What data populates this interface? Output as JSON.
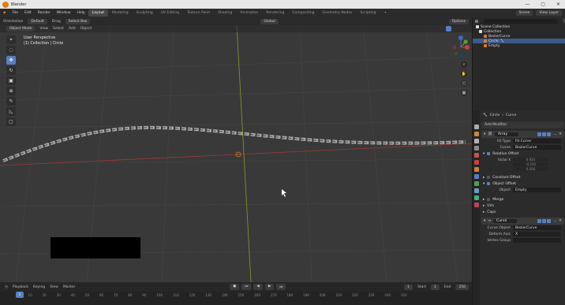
{
  "window": {
    "title": "Blender",
    "controls": [
      "—",
      "▢",
      "✕"
    ]
  },
  "menu": [
    "File",
    "Edit",
    "Render",
    "Window",
    "Help"
  ],
  "workspaces": [
    "Layout",
    "Modeling",
    "Sculpting",
    "UV Editing",
    "Texture Paint",
    "Shading",
    "Animation",
    "Rendering",
    "Compositing",
    "Geometry Nodes",
    "Scripting",
    "+"
  ],
  "active_workspace": "Layout",
  "scene": {
    "label": "Scene",
    "view_layer": "View Layer"
  },
  "tool_header": {
    "orientation": "Orientation",
    "default": "Default",
    "drag": "Drag",
    "select_box": "Select Box"
  },
  "view_header": {
    "mode": "Object Mode",
    "view": "View",
    "select": "Select",
    "add": "Add",
    "object": "Object",
    "global": "Global",
    "options": "Options"
  },
  "viewport": {
    "info_line1": "User Perspective",
    "info_line2": "(1) Collection | Circle"
  },
  "toolbar_icons": [
    "cursor-icon",
    "select-icon",
    "move-icon",
    "rotate-icon",
    "scale-icon",
    "transform-icon",
    "annotate-icon",
    "measure-icon",
    "add-cube-icon"
  ],
  "gizmo": {
    "x": "X",
    "y": "Y",
    "z": "Z"
  },
  "timeline": {
    "playback": "Playback",
    "keying": "Keying",
    "view": "View",
    "marker": "Marker",
    "current_frame": "1",
    "start_label": "Start",
    "start": "1",
    "end_label": "End",
    "end": "250",
    "frame_ticks": [
      "0",
      "10",
      "20",
      "30",
      "40",
      "50",
      "60",
      "70",
      "80",
      "90",
      "100",
      "110",
      "120",
      "130",
      "140",
      "150",
      "160",
      "170",
      "180",
      "190",
      "200",
      "210",
      "220",
      "230",
      "240",
      "250"
    ]
  },
  "outliner": {
    "root": "Scene Collection",
    "collection": "Collection",
    "items": [
      "BezierCurve",
      "Circle",
      "Empty"
    ]
  },
  "properties": {
    "path_object": "Circle",
    "path_data": "Curve",
    "add_modifier": "Add Modifier",
    "array": {
      "name": "Array",
      "fit_type_label": "Fit Type",
      "fit_type": "Fit Curve",
      "curve_label": "Curve",
      "curve": "BezierCurve",
      "relative_offset": "Relative Offset",
      "factor_label": "Factor X",
      "factor_x": "0.920",
      "factor_y": "-0.250",
      "factor_z": "0.000",
      "constant_offset": "Constant Offset",
      "object_offset": "Object Offset",
      "object_label": "Object",
      "object": "Empty",
      "merge": "Merge",
      "uvs": "UVs",
      "caps": "Caps"
    },
    "curve_mod": {
      "name": "Curve",
      "curve_object_label": "Curve Object",
      "curve_object": "BezierCurve",
      "deform_axis_label": "Deform Axis",
      "deform_axis": "X",
      "vertex_group_label": "Vertex Group"
    }
  },
  "colors": {
    "accent": "#5680c2",
    "x_axis": "#9b3a3a",
    "y_axis": "#8a9a2a",
    "origin": "#e07a2a"
  }
}
